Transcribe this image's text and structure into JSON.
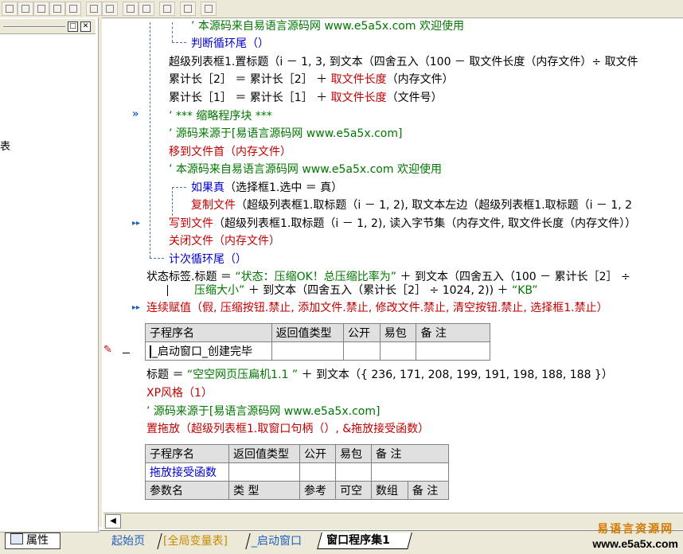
{
  "code": {
    "l1": "’ 本源码来自易语言源码网 www.e5a5x.com  欢迎使用",
    "l2": "判断循环尾（）",
    "l3": "超级列表框1.置标题（i － 1, 3, 到文本（四舍五入（100 － 取文件长度（内存文件）÷ 取文件",
    "l4a": "累计长［2］ ＝ 累计长［2］ ＋ ",
    "l4b": "取文件长度",
    "l4c": "（内存文件）",
    "l5a": "累计长［1］ ＝ 累计长［1］ ＋ ",
    "l5b": "取文件长度",
    "l5c": "（文件号）",
    "l6": "’ *** 缩略程序块 ***",
    "l7": "’ 源码来源于[易语言源码网 www.e5a5x.com]",
    "l8": "移到文件首（内存文件）",
    "l9": "’ 本源码来自易语言源码网 www.e5a5x.com  欢迎使用",
    "l10a": "如果真",
    "l10b": "（选择框1.选中 ＝ 真）",
    "l11a": "复制文件",
    "l11b": "（超级列表框1.取标题（i － 1, 2), 取文本左边（超级列表框1.取标题（i － 1, 2",
    "l12a": "写到文件",
    "l12b": "（超级列表框1.取标题（i － 1, 2), 读入字节集（内存文件, 取文件长度（内存文件））",
    "l13": "关闭文件（内存文件）",
    "l14": "计次循环尾（）",
    "l15a": "状态标签.标题 ＝ ",
    "l15b": "“状态：压缩OK！总压缩比率为”",
    "l15c": " ＋ 到文本（四舍五入（100 － 累计长［2］ ÷",
    "l16a": "压缩大小”",
    "l16b": " ＋ 到文本（四舍五入（累计长［2］ ÷ 1024, 2)) ＋ ",
    "l16c": "“KB”",
    "l17": "连续赋值（假, 压缩按钮.禁止, 添加文件.禁止, 修改文件.禁止, 清空按钮.禁止, 选择框1.禁止）",
    "l18a": "标题 ＝ ",
    "l18b": "“空空网页压扁机1.1    ”",
    "l18c": " ＋ 到文本（{ 236, 171, 208, 199, 191, 198, 188, 188 }）",
    "l19": "XP风格（1）",
    "l20": "’ 源码来源于[易语言源码网 www.e5a5x.com]",
    "l21": "置拖放（超级列表框1.取窗口句柄（）, &拖放接受函数）"
  },
  "table1": {
    "headers": [
      "子程序名",
      "返回值类型",
      "公开",
      "易包",
      "备 注"
    ],
    "row": [
      "_启动窗口_创建完毕",
      "",
      "",
      "",
      ""
    ]
  },
  "table2": {
    "headers": [
      "子程序名",
      "返回值类型",
      "公开",
      "易包",
      "备 注"
    ],
    "row1": [
      "拖放接受函数",
      "",
      "",
      "",
      ""
    ],
    "param_headers": [
      "参数名",
      "类 型",
      "参考",
      "可空",
      "数组",
      "备 注"
    ]
  },
  "left_panel": {
    "fragment": "表",
    "properties_label": "属性"
  },
  "tabs": [
    "起始页",
    "[全局变量表]",
    "_启动窗口",
    "窗口程序集1"
  ],
  "watermark": {
    "line1": "易语言资源网",
    "line2": "www.e5a5x.com"
  },
  "colors": {
    "keyword": "#c00000",
    "comment": "#007700",
    "link": "#0000cc"
  }
}
